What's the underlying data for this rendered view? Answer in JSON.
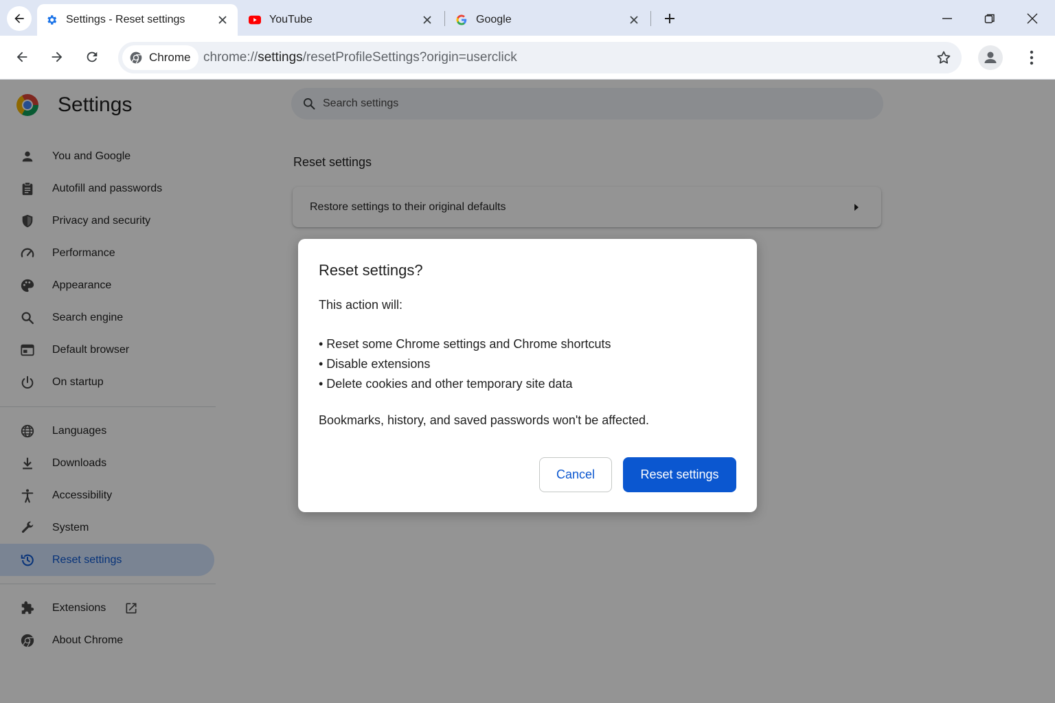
{
  "browser": {
    "tabs": [
      {
        "title": "Settings - Reset settings",
        "icon": "gear-icon",
        "active": true
      },
      {
        "title": "YouTube",
        "icon": "youtube-icon",
        "active": false
      },
      {
        "title": "Google",
        "icon": "google-icon",
        "active": false
      }
    ],
    "omnibox": {
      "chip_label": "Chrome",
      "url_prefix": "chrome://",
      "url_host": "settings",
      "url_path": "/resetProfileSettings?origin=userclick"
    }
  },
  "settings": {
    "title": "Settings",
    "search_placeholder": "Search settings",
    "nav": [
      {
        "label": "You and Google",
        "icon": "person-icon"
      },
      {
        "label": "Autofill and passwords",
        "icon": "clipboard-icon"
      },
      {
        "label": "Privacy and security",
        "icon": "shield-icon"
      },
      {
        "label": "Performance",
        "icon": "speedometer-icon"
      },
      {
        "label": "Appearance",
        "icon": "palette-icon"
      },
      {
        "label": "Search engine",
        "icon": "search-icon"
      },
      {
        "label": "Default browser",
        "icon": "browser-window-icon"
      },
      {
        "label": "On startup",
        "icon": "power-icon"
      },
      {
        "label": "Languages",
        "icon": "globe-icon"
      },
      {
        "label": "Downloads",
        "icon": "download-icon"
      },
      {
        "label": "Accessibility",
        "icon": "accessibility-icon"
      },
      {
        "label": "System",
        "icon": "wrench-icon"
      },
      {
        "label": "Reset settings",
        "icon": "history-icon",
        "selected": true
      },
      {
        "label": "Extensions",
        "icon": "puzzle-icon"
      },
      {
        "label": "About Chrome",
        "icon": "chrome-icon"
      }
    ],
    "section_title": "Reset settings",
    "card_label": "Restore settings to their original defaults"
  },
  "dialog": {
    "title": "Reset settings?",
    "intro": "This action will:",
    "items": [
      "• Reset some Chrome settings and Chrome shortcuts",
      "• Disable extensions",
      "• Delete cookies and other temporary site data"
    ],
    "note": "Bookmarks, history, and saved passwords won't be affected.",
    "cancel_label": "Cancel",
    "confirm_label": "Reset settings"
  },
  "colors": {
    "accent": "#0b57d0",
    "selected_nav_bg": "#d3e3fd",
    "tabstrip_bg": "#dfe6f4",
    "scrim": "rgba(0,0,0,0.42)"
  }
}
